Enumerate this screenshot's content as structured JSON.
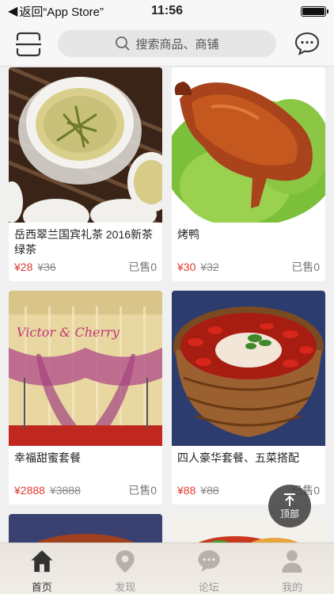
{
  "status_bar": {
    "back_label": "返回“App Store”",
    "time": "11:56"
  },
  "header": {
    "search_placeholder": "搜索商品、商铺"
  },
  "products": [
    {
      "name": "岳西翠兰国宾礼茶 2016新茶 绿茶",
      "price": "¥28",
      "original_price": "¥36",
      "sold": "已售0"
    },
    {
      "name": "烤鸭",
      "price": "¥30",
      "original_price": "¥32",
      "sold": "已售0"
    },
    {
      "name": "幸福甜蜜套餐",
      "price": "¥2888",
      "original_price": "¥3888",
      "sold": "已售0"
    },
    {
      "name": "四人豪华套餐、五菜搭配",
      "price": "¥88",
      "original_price": "¥88",
      "sold": "已售0"
    }
  ],
  "back_to_top": {
    "label": "顶部"
  },
  "tabs": [
    {
      "label": "首页",
      "icon": "home-icon",
      "active": true
    },
    {
      "label": "发现",
      "icon": "location-pin-icon",
      "active": false
    },
    {
      "label": "论坛",
      "icon": "chat-bubble-icon",
      "active": false
    },
    {
      "label": "我的",
      "icon": "user-icon",
      "active": false
    }
  ],
  "colors": {
    "price_red": "#e03a30",
    "page_bg": "#f0f0f0",
    "tab_active": "#333333",
    "tab_inactive": "#999999"
  }
}
